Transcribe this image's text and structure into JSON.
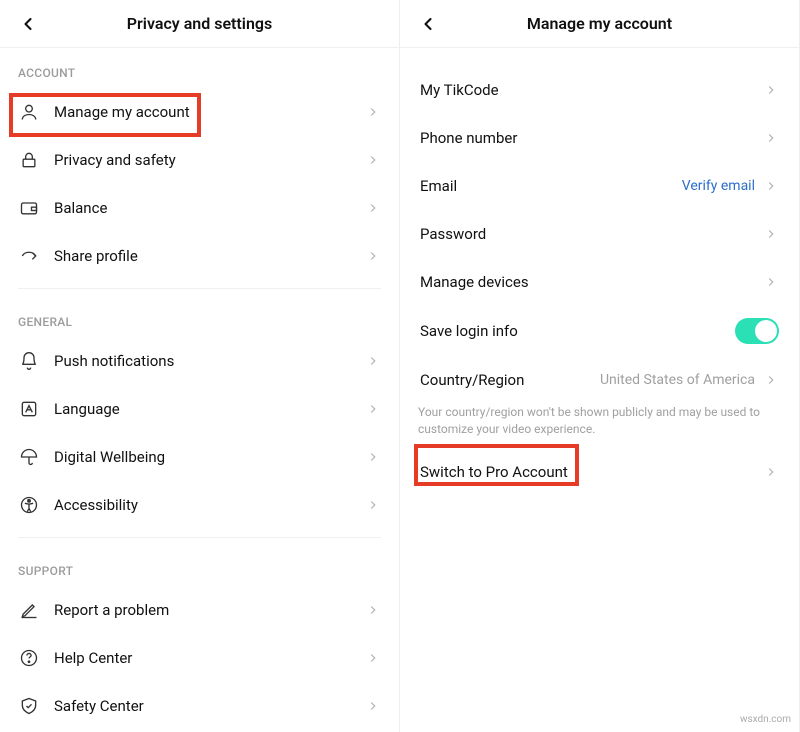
{
  "left": {
    "title": "Privacy and settings",
    "sections": {
      "account": {
        "label": "ACCOUNT",
        "items": [
          {
            "label": "Manage my account"
          },
          {
            "label": "Privacy and safety"
          },
          {
            "label": "Balance"
          },
          {
            "label": "Share profile"
          }
        ]
      },
      "general": {
        "label": "GENERAL",
        "items": [
          {
            "label": "Push notifications"
          },
          {
            "label": "Language"
          },
          {
            "label": "Digital Wellbeing"
          },
          {
            "label": "Accessibility"
          }
        ]
      },
      "support": {
        "label": "SUPPORT",
        "items": [
          {
            "label": "Report a problem"
          },
          {
            "label": "Help Center"
          },
          {
            "label": "Safety Center"
          }
        ]
      }
    }
  },
  "right": {
    "title": "Manage my account",
    "items": {
      "tikcode": {
        "label": "My TikCode"
      },
      "phone": {
        "label": "Phone number"
      },
      "email": {
        "label": "Email",
        "value": "Verify email"
      },
      "password": {
        "label": "Password"
      },
      "devices": {
        "label": "Manage devices"
      },
      "savelogin": {
        "label": "Save login info"
      },
      "country": {
        "label": "Country/Region",
        "value": "United States of America"
      },
      "country_hint": "Your country/region won't be shown publicly and may be used to customize your video experience.",
      "switchpro": {
        "label": "Switch to Pro Account"
      }
    }
  },
  "watermark": "wsxdn.com"
}
